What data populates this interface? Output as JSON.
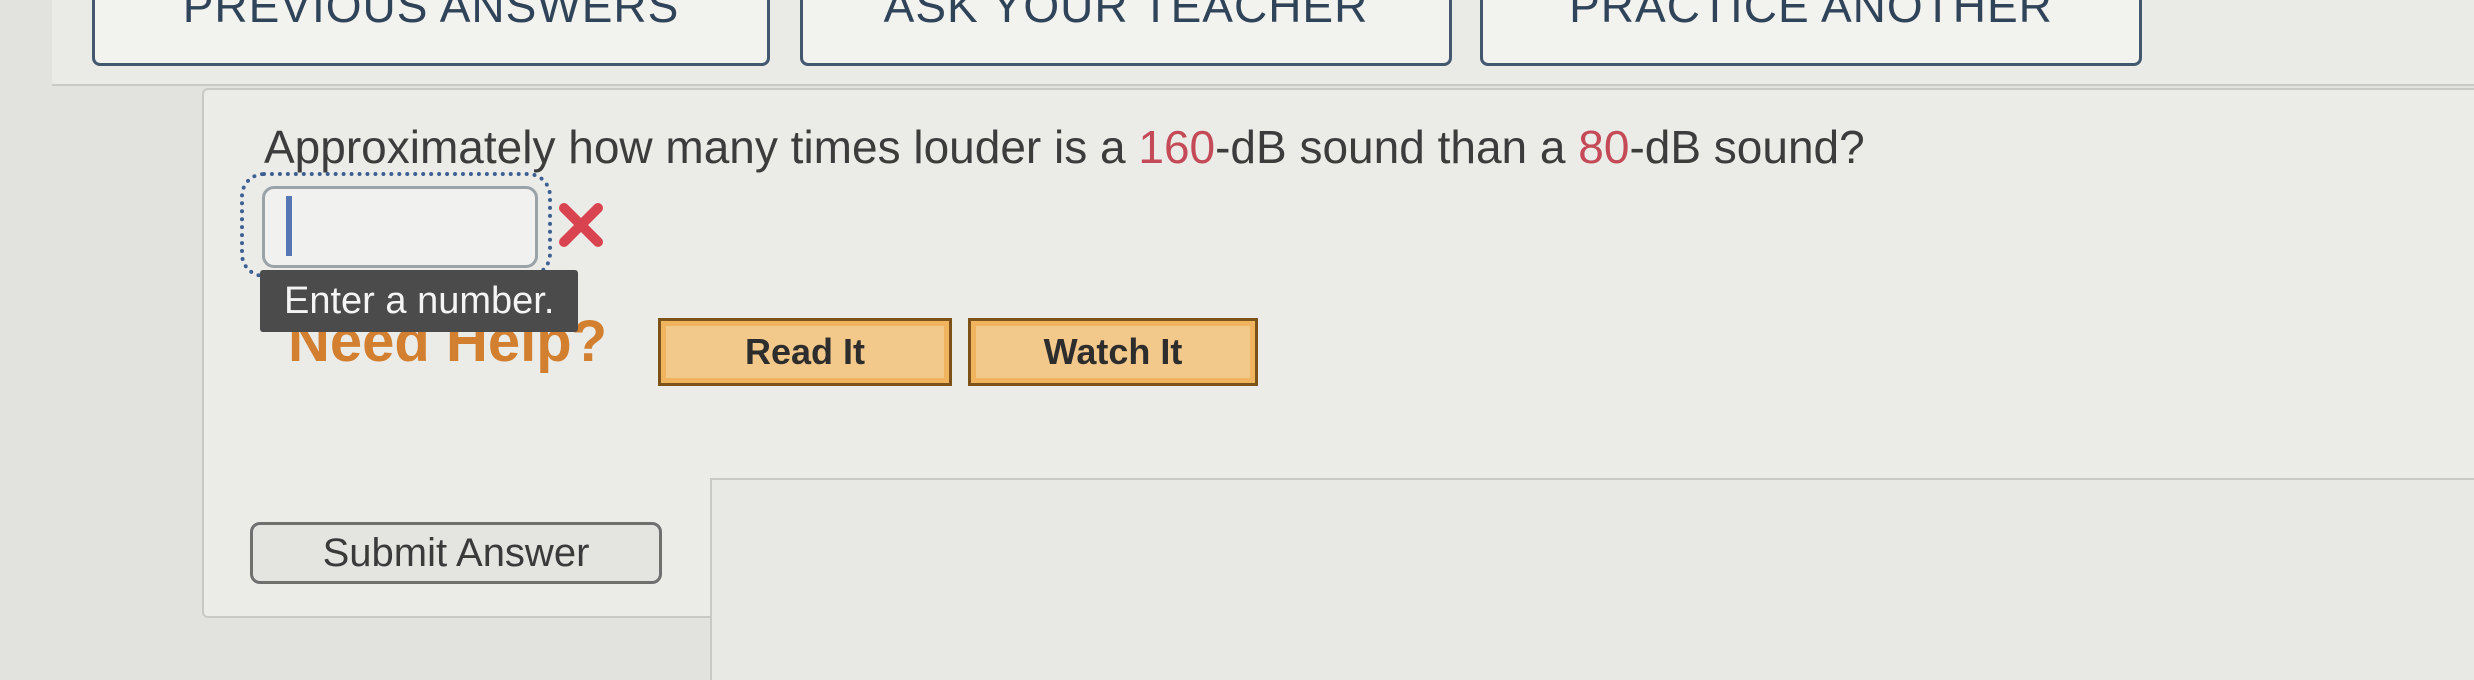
{
  "top_buttons": {
    "previous_answers": "PREVIOUS ANSWERS",
    "ask_teacher": "ASK YOUR TEACHER",
    "practice_another": "PRACTICE ANOTHER"
  },
  "question": {
    "part1": "Approximately how many times louder is a ",
    "value1": "160",
    "part2": "-dB sound than a ",
    "value2": "80",
    "part3": "-dB sound?"
  },
  "answer": {
    "value": "",
    "error_tooltip": "Enter a number."
  },
  "help": {
    "label": "Need Help?",
    "read_it": "Read It",
    "watch_it": "Watch It"
  },
  "submit_label": "Submit Answer",
  "colors": {
    "highlight": "#c44a57",
    "error": "#d9434f",
    "help_accent": "#d27f2f",
    "button_navy": "#43576f"
  }
}
